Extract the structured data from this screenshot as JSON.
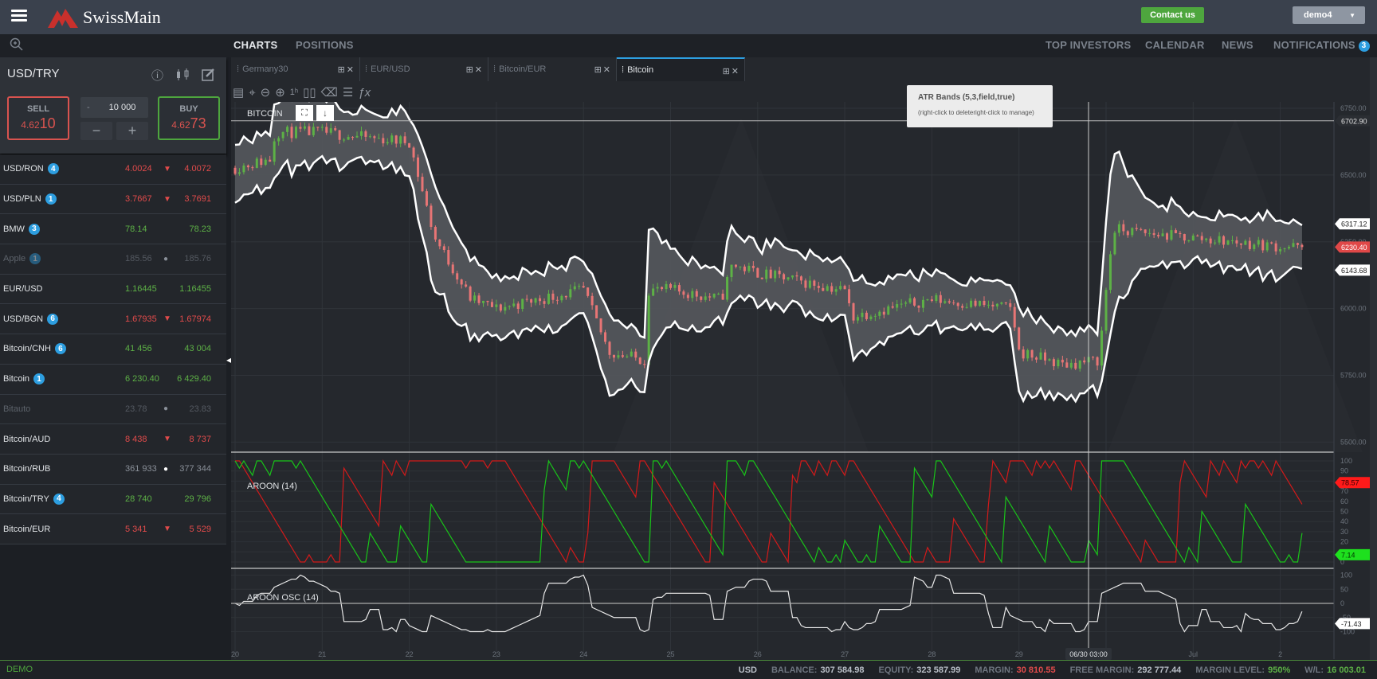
{
  "header": {
    "logo_text": "SwissMain",
    "contact_label": "Contact us",
    "user_label": "demo4"
  },
  "nav": {
    "charts": "CHARTS",
    "positions": "POSITIONS",
    "top_investors": "TOP INVESTORS",
    "calendar": "CALENDAR",
    "news": "NEWS",
    "notifications": "NOTIFICATIONS",
    "notifications_count": "3"
  },
  "panel": {
    "symbol": "USD/TRY",
    "sell_label": "SELL",
    "sell_price_small": "4.62",
    "sell_price_big": "10",
    "buy_label": "BUY",
    "buy_price_small": "4.62",
    "buy_price_big": "73",
    "qty_minus": "-",
    "qty": "10 000",
    "minus": "−",
    "plus": "+"
  },
  "instruments": [
    {
      "name": "USD/RON",
      "badge": "4",
      "bid": "4.0024",
      "ask": "4.0072",
      "state": "red",
      "arrow": "▼"
    },
    {
      "name": "USD/PLN",
      "badge": "1",
      "bid": "3.7667",
      "ask": "3.7691",
      "state": "red",
      "arrow": "▼"
    },
    {
      "name": "BMW",
      "badge": "3",
      "bid": "78.14",
      "ask": "78.23",
      "state": "green",
      "arrow": ""
    },
    {
      "name": "Apple",
      "badge": "1",
      "bid": "185.56",
      "ask": "185.76",
      "state": "dim",
      "arrow": "●"
    },
    {
      "name": "EUR/USD",
      "badge": "",
      "bid": "1.16445",
      "ask": "1.16455",
      "state": "green",
      "arrow": ""
    },
    {
      "name": "USD/BGN",
      "badge": "6",
      "bid": "1.67935",
      "ask": "1.67974",
      "state": "red",
      "arrow": "▼"
    },
    {
      "name": "Bitcoin/CNH",
      "badge": "6",
      "bid": "41 456",
      "ask": "43 004",
      "state": "green",
      "arrow": ""
    },
    {
      "name": "Bitcoin",
      "badge": "1",
      "bid": "6 230.40",
      "ask": "6 429.40",
      "state": "green",
      "arrow": ""
    },
    {
      "name": "Bitauto",
      "badge": "",
      "bid": "23.78",
      "ask": "23.83",
      "state": "dim",
      "arrow": "●"
    },
    {
      "name": "Bitcoin/AUD",
      "badge": "",
      "bid": "8 438",
      "ask": "8 737",
      "state": "red",
      "arrow": "▼"
    },
    {
      "name": "Bitcoin/RUB",
      "badge": "",
      "bid": "361 933",
      "ask": "377 344",
      "state": "gray",
      "arrow": "●"
    },
    {
      "name": "Bitcoin/TRY",
      "badge": "4",
      "bid": "28 740",
      "ask": "29 796",
      "state": "green",
      "arrow": ""
    },
    {
      "name": "Bitcoin/EUR",
      "badge": "",
      "bid": "5 341",
      "ask": "5 529",
      "state": "red",
      "arrow": "▼"
    }
  ],
  "tabs": [
    {
      "label": "Germany30"
    },
    {
      "label": "EUR/USD"
    },
    {
      "label": "Bitcoin/EUR"
    },
    {
      "label": "Bitcoin",
      "active": true
    }
  ],
  "chart": {
    "symbol_label": "BITCOIN",
    "aroon_label": "AROON (14)",
    "osc_label": "AROON OSC (14)",
    "tooltip_title": "ATR Bands (5,3,field,true)",
    "tooltip_hint": "(right-click to deleteright-click to manage)",
    "crosshair_time": "06/30 03:00"
  },
  "colors": {
    "up": "#5db146",
    "down": "#e87575",
    "aroon_up": "#19c419",
    "aroon_down": "#d31a1a",
    "band": "#ffffff",
    "accent": "#2d9ee0",
    "brand_green": "#4ea63e"
  },
  "footer": {
    "mode": "DEMO",
    "currency": "USD",
    "balance_label": "BALANCE:",
    "balance": "307 584.98",
    "equity_label": "EQUITY:",
    "equity": "323 587.99",
    "margin_label": "MARGIN:",
    "margin": "30 810.55",
    "free_margin_label": "FREE MARGIN:",
    "free_margin": "292 777.44",
    "margin_level_label": "MARGIN LEVEL:",
    "margin_level": "950%",
    "wl_label": "W/L:",
    "wl": "16 003.01"
  },
  "chart_data": {
    "type": "candlestick",
    "price_axis": {
      "range": [
        5500,
        6750
      ],
      "ticks": [
        "6750.00",
        "6500.00",
        "6250.00",
        "6000.00",
        "5750.00",
        "5500.00"
      ]
    },
    "x_ticks": [
      "20",
      "21",
      "22",
      "23",
      "24",
      "25",
      "26",
      "27",
      "28",
      "29",
      "30",
      "Jul",
      "2"
    ],
    "price_path": [
      [
        "06/20 00:00",
        6527
      ],
      [
        "06/20 10:00",
        6560
      ],
      [
        "06/20 11:00",
        6660
      ],
      [
        "06/21 00:00",
        6660
      ],
      [
        "06/21 12:00",
        6640
      ],
      [
        "06/22 00:00",
        6625
      ],
      [
        "06/22 07:00",
        6265
      ],
      [
        "06/22 17:00",
        6035
      ],
      [
        "06/23 00:00",
        6000
      ],
      [
        "06/23 12:00",
        6035
      ],
      [
        "06/24 00:00",
        6070
      ],
      [
        "06/24 07:00",
        5838
      ],
      [
        "06/24 17:00",
        5806
      ],
      [
        "06/24 18:00",
        6070
      ],
      [
        "06/25 00:00",
        6070
      ],
      [
        "06/25 14:00",
        6035
      ],
      [
        "06/25 17:00",
        6166
      ],
      [
        "06/26 00:00",
        6133
      ],
      [
        "06/26 12:00",
        6100
      ],
      [
        "06/27 00:00",
        6070
      ],
      [
        "06/27 02:00",
        5970
      ],
      [
        "06/27 12:00",
        6000
      ],
      [
        "06/28 00:00",
        6035
      ],
      [
        "06/28 22:00",
        6000
      ],
      [
        "06/29 00:00",
        5838
      ],
      [
        "06/29 12:00",
        5790
      ],
      [
        "06/29 22:00",
        5806
      ],
      [
        "06/30 00:00",
        6070
      ],
      [
        "06/30 02:00",
        6297
      ],
      [
        "06/30 12:00",
        6280
      ],
      [
        "07/01 00:00",
        6265
      ],
      [
        "07/02 00:00",
        6232
      ],
      [
        "07/02 07:00",
        6230.4
      ]
    ],
    "last_price": "6230.40",
    "band_upper": "6317.12",
    "band_lower": "6143.68",
    "crosshair_price": "6702.90",
    "aroon": {
      "period": 14,
      "up_last": "7.14",
      "down_last": "78.57",
      "ticks": [
        "100",
        "90",
        "80",
        "70",
        "60",
        "50",
        "40",
        "30",
        "20",
        "10",
        "0"
      ]
    },
    "aroon_osc": {
      "period": 14,
      "last": "-71.43",
      "ticks": [
        "100",
        "50",
        "0",
        "-50",
        "-100"
      ]
    },
    "grid": true
  }
}
